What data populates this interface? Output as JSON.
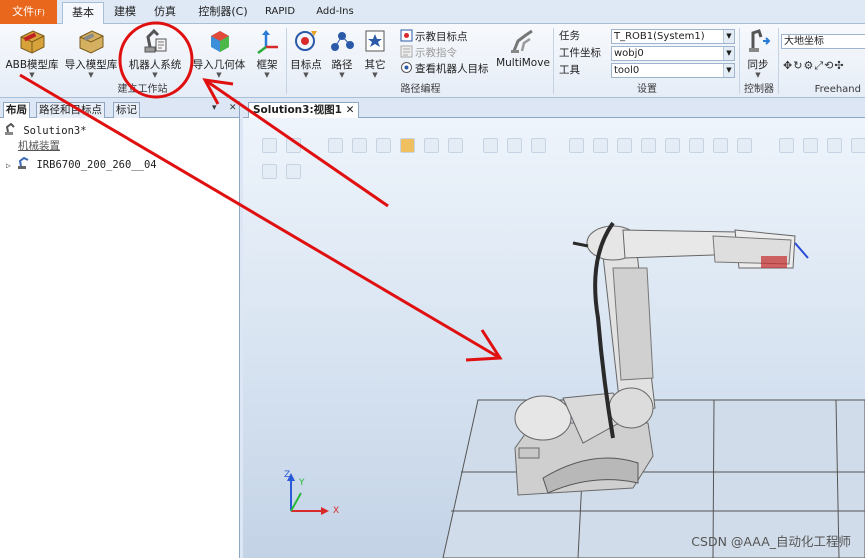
{
  "menu": {
    "file": "文件",
    "file_key": "(F)",
    "tabs": [
      "基本",
      "建模",
      "仿真",
      "控制器(C)",
      "RAPID",
      "Add-Ins"
    ]
  },
  "ribbon": {
    "build_station": {
      "label": "建立工作站",
      "abb_library": "ABB模型库",
      "import_library": "导入模型库",
      "robot_system": "机器人系统",
      "import_geometry": "导入几何体",
      "frame": "框架"
    },
    "path_programming": {
      "label": "路径编程",
      "target": "目标点",
      "path": "路径",
      "other": "其它",
      "teach_target": "示教目标点",
      "teach_instruction": "示教指令",
      "view_robot_target": "查看机器人目标",
      "multimove": "MultiMove"
    },
    "settings": {
      "label": "设置",
      "task_label": "任务",
      "task_value": "T_ROB1(System1)",
      "workobject_label": "工件坐标",
      "workobject_value": "wobj0",
      "tool_label": "工具",
      "tool_value": "tool0"
    },
    "controller": {
      "label": "控制器",
      "sync": "同步"
    },
    "freehand": {
      "label": "Freehand",
      "ground_frame": "大地坐标"
    }
  },
  "left_panel": {
    "tabs": [
      "布局",
      "路径和目标点",
      "标记"
    ],
    "solution": "Solution3*",
    "mechanism_header": "机械装置",
    "robot": "IRB6700_200_260__04"
  },
  "viewport": {
    "tab": "Solution3:视图1",
    "axes": {
      "x": "X",
      "y": "Y",
      "z": "Z"
    }
  },
  "watermark": "CSDN @AAA_自动化工程师",
  "colors": {
    "file_tab": "#e8671c",
    "annotation": "#e01010",
    "robot_body": "#dcdcdc"
  }
}
